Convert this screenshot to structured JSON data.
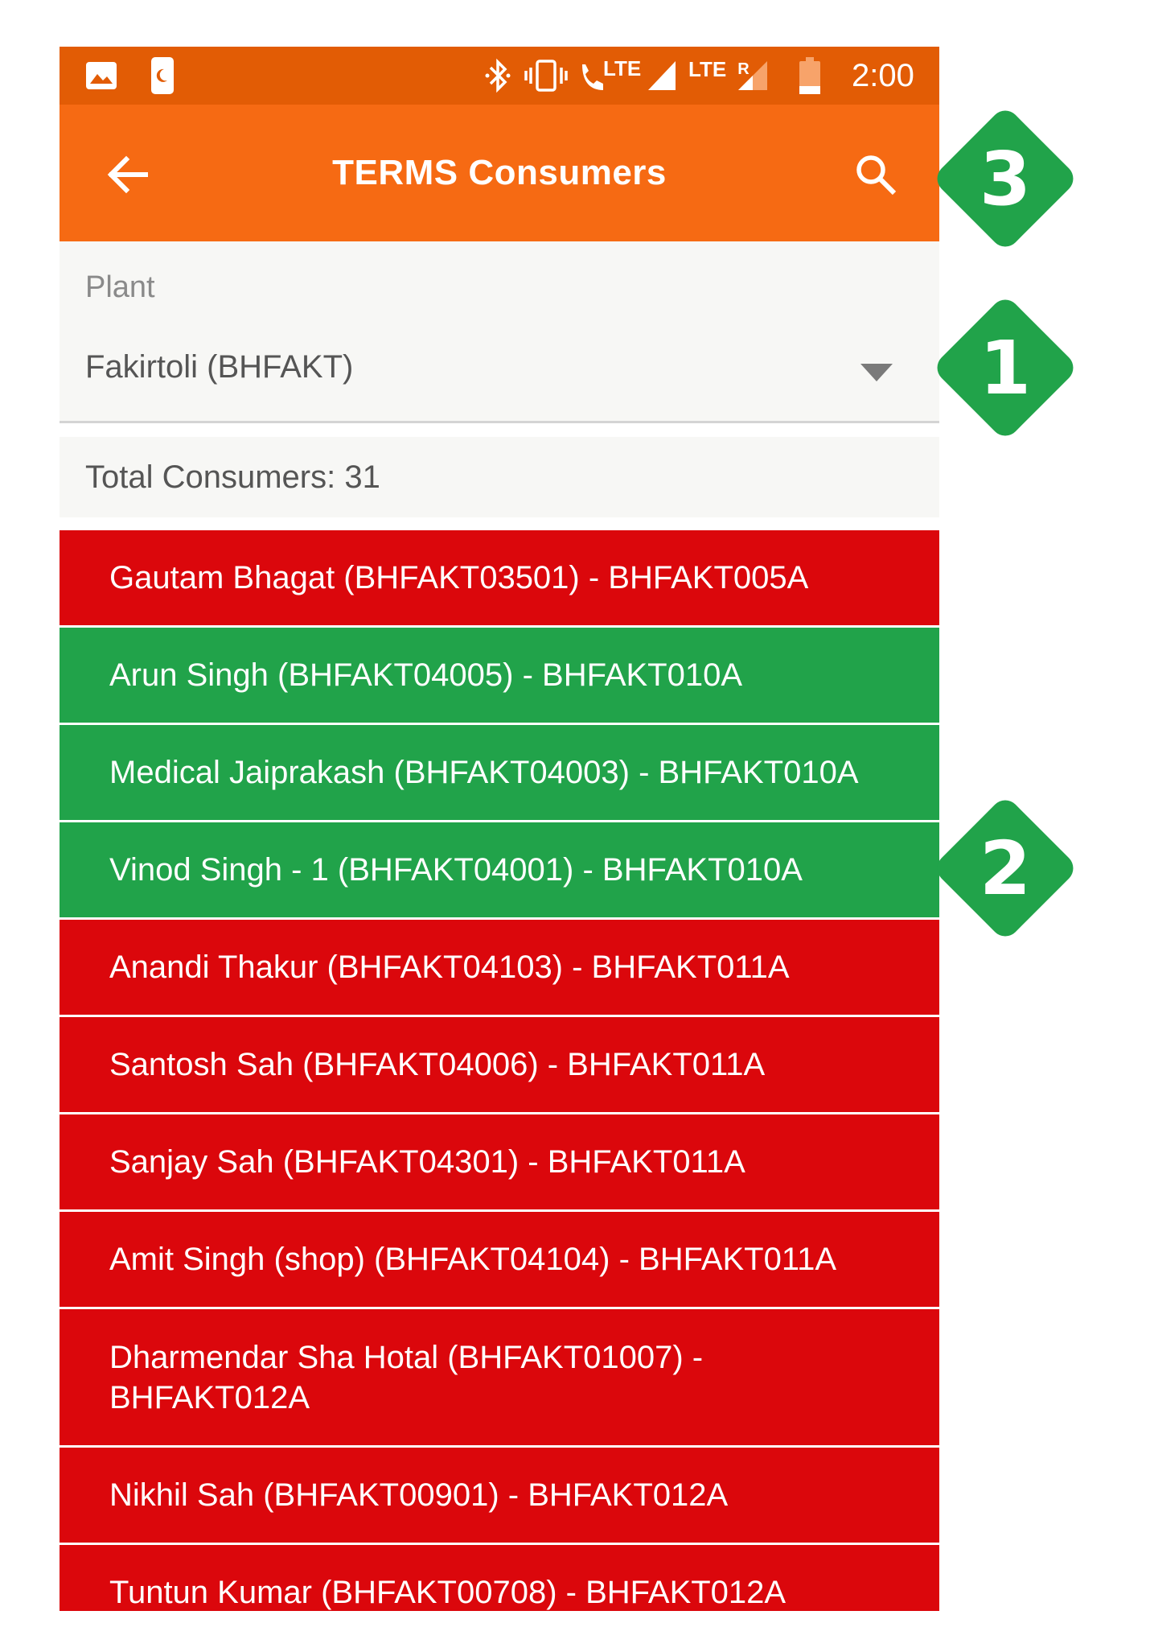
{
  "status_bar": {
    "time": "2:00",
    "lte_label_1": "LTE",
    "lte_label_2": "LTE",
    "roaming_label": "R",
    "icons": [
      "image-icon",
      "notification-icon",
      "bluetooth-icon",
      "vibrate-icon",
      "volte-call-icon",
      "signal-icon",
      "signal-roaming-icon",
      "battery-icon"
    ]
  },
  "app_bar": {
    "title": "TERMS Consumers",
    "back_icon": "arrow-back-icon",
    "search_icon": "search-icon",
    "color": "#f66a13"
  },
  "plant": {
    "label": "Plant",
    "selected": "Fakirtoli (BHFAKT)"
  },
  "summary": {
    "total_text": "Total Consumers: 31"
  },
  "consumers": [
    {
      "text": "Gautam Bhagat (BHFAKT03501) - BHFAKT005A",
      "status": "red"
    },
    {
      "text": "Arun Singh (BHFAKT04005) - BHFAKT010A",
      "status": "green"
    },
    {
      "text": "Medical  Jaiprakash (BHFAKT04003) - BHFAKT010A",
      "status": "green"
    },
    {
      "text": "Vinod Singh - 1 (BHFAKT04001) - BHFAKT010A",
      "status": "green"
    },
    {
      "text": "Anandi Thakur (BHFAKT04103) - BHFAKT011A",
      "status": "red"
    },
    {
      "text": "Santosh Sah (BHFAKT04006) - BHFAKT011A",
      "status": "red"
    },
    {
      "text": "Sanjay Sah (BHFAKT04301) - BHFAKT011A",
      "status": "red"
    },
    {
      "text": "Amit Singh (shop) (BHFAKT04104) - BHFAKT011A",
      "status": "red"
    },
    {
      "text": "Dharmendar Sha Hotal (BHFAKT01007) - BHFAKT012A",
      "status": "red"
    },
    {
      "text": "Nikhil Sah (BHFAKT00901) - BHFAKT012A",
      "status": "red"
    },
    {
      "text": "Tuntun Kumar (BHFAKT00708) - BHFAKT012A",
      "status": "red"
    }
  ],
  "callouts": [
    {
      "number": "3"
    },
    {
      "number": "1"
    },
    {
      "number": "2"
    }
  ],
  "colors": {
    "status_bar": "#e25c05",
    "red_row": "#db070c",
    "green_row": "#21a34a",
    "callout": "#21a34a"
  }
}
